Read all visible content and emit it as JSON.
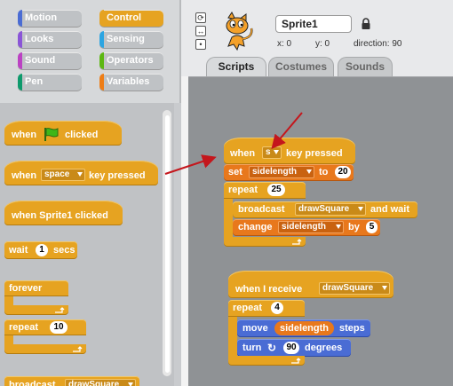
{
  "categories": [
    {
      "label": "Motion",
      "color": "#4a6cd4"
    },
    {
      "label": "Control",
      "color": "#e6a321",
      "active": true
    },
    {
      "label": "Looks",
      "color": "#8a55d7"
    },
    {
      "label": "Sensing",
      "color": "#2ca5e2"
    },
    {
      "label": "Sound",
      "color": "#bb42c3"
    },
    {
      "label": "Operators",
      "color": "#5cb712"
    },
    {
      "label": "Pen",
      "color": "#0e9a6c"
    },
    {
      "label": "Variables",
      "color": "#ee7d16"
    }
  ],
  "palette": {
    "when_flag": {
      "t1": "when",
      "t2": "clicked"
    },
    "when_key": {
      "t1": "when",
      "key": "space",
      "t2": "key pressed"
    },
    "when_sprite": {
      "t1": "when Sprite1 clicked"
    },
    "wait": {
      "t1": "wait",
      "val": "1",
      "t2": "secs"
    },
    "forever": {
      "t1": "forever"
    },
    "repeat": {
      "t1": "repeat",
      "val": "10"
    },
    "broadcast": {
      "t1": "broadcast",
      "msg": "drawSquare"
    }
  },
  "sprite": {
    "name": "Sprite1",
    "x_label": "x: 0",
    "y_label": "y: 0",
    "direction_label": "direction: 90"
  },
  "tabs": [
    {
      "label": "Scripts",
      "active": true
    },
    {
      "label": "Costumes"
    },
    {
      "label": "Sounds"
    }
  ],
  "script1": {
    "hat": {
      "t1": "when",
      "key": "s",
      "t2": "key pressed"
    },
    "set": {
      "t1": "set",
      "var": "sidelength",
      "t2": "to",
      "val": "20"
    },
    "repeat": {
      "t1": "repeat",
      "val": "25"
    },
    "broadcast": {
      "t1": "broadcast",
      "msg": "drawSquare",
      "t2": "and wait"
    },
    "change": {
      "t1": "change",
      "var": "sidelength",
      "t2": "by",
      "val": "5"
    }
  },
  "script2": {
    "hat": {
      "t1": "when I receive",
      "msg": "drawSquare"
    },
    "repeat": {
      "t1": "repeat",
      "val": "4"
    },
    "move": {
      "t1": "move",
      "reporter": "sidelength",
      "t2": "steps"
    },
    "turn": {
      "t1": "turn",
      "icon": "↻",
      "val": "90",
      "t2": "degrees"
    }
  },
  "icons": {
    "flag": "green-flag-icon",
    "lock": "lock-icon",
    "sprite_thumb": "cat-sprite-icon"
  }
}
